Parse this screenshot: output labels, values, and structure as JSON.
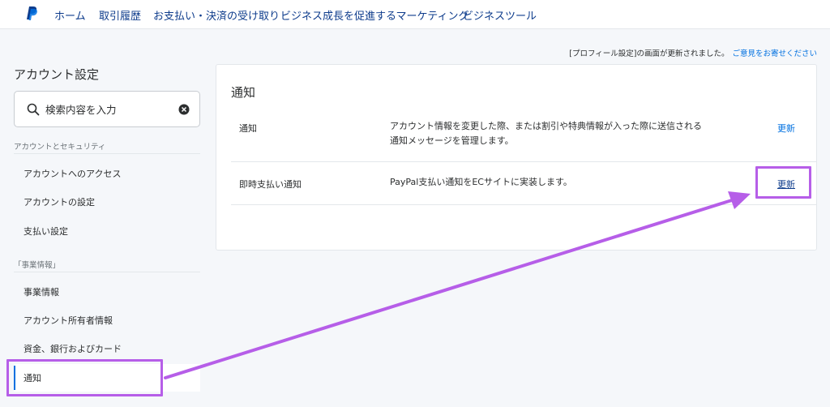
{
  "nav": {
    "items": [
      "ホーム",
      "取引履歴",
      "お支払い・決済の受け取り",
      "ビジネス成長を促進するマーケティング",
      "ビジネスツール"
    ]
  },
  "feedback": {
    "text": "[プロフィール設定]の画面が更新されました。",
    "link": "ご意見をお寄せください"
  },
  "sidebar": {
    "title": "アカウント設定",
    "search_placeholder": "検索内容を入力",
    "sections": [
      {
        "label": "アカウントとセキュリティ",
        "items": [
          "アカウントへのアクセス",
          "アカウントの設定",
          "支払い設定"
        ]
      },
      {
        "label": "「事業情報」",
        "items": [
          "事業情報",
          "アカウント所有者情報",
          "資金、銀行およびカード",
          "通知"
        ]
      }
    ]
  },
  "main": {
    "title": "通知",
    "rows": [
      {
        "name": "通知",
        "desc_line1": "アカウント情報を変更した際、または割引や特典情報が入った際に送信される",
        "desc_line2": "通知メッセージを管理します。",
        "link": "更新"
      },
      {
        "name": "即時支払い通知",
        "desc_line1": "PayPal支払い通知をECサイトに実装します。",
        "link": "更新"
      }
    ]
  },
  "colors": {
    "brand_dark": "#0e3c8c",
    "link": "#0070e0",
    "annotation": "#b65ee8"
  }
}
